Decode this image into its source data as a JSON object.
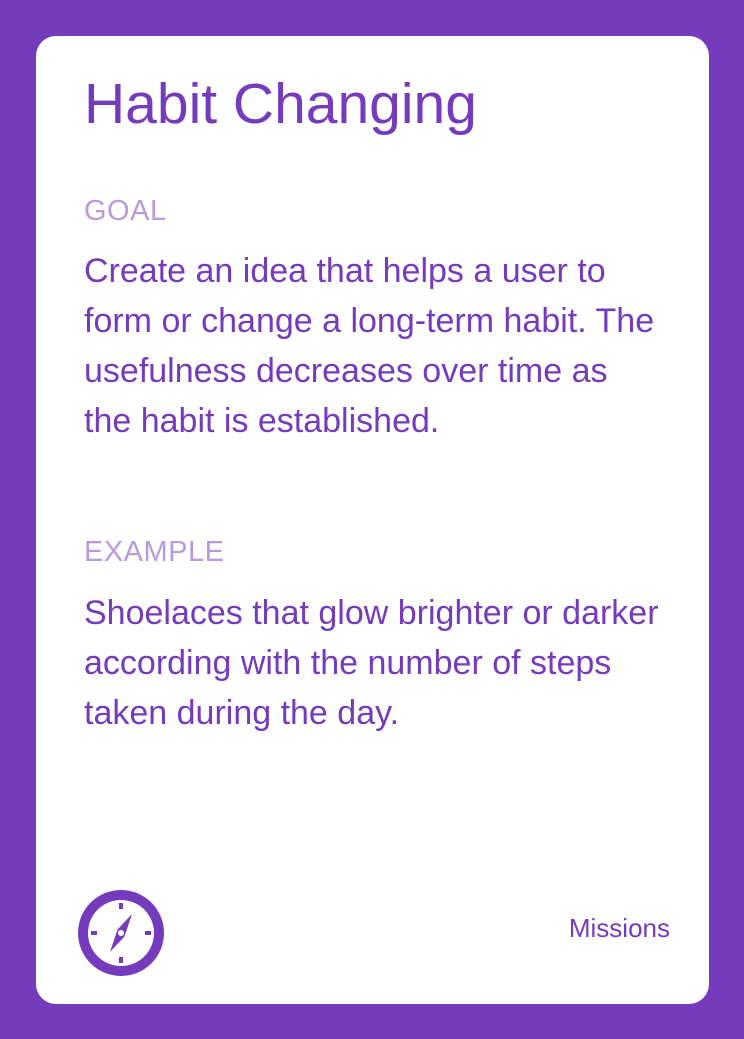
{
  "card": {
    "title": "Habit Changing",
    "goal": {
      "label": "GOAL",
      "text": "Create an idea that helps a user to form or change a long-term habit. The usefulness decreases over time as the habit is established."
    },
    "example": {
      "label": "EXAMPLE",
      "text": "Shoelaces that glow brighter or darker according with the number of steps taken during the day."
    },
    "footer": {
      "icon": "compass-icon",
      "category": "Missions"
    }
  },
  "colors": {
    "background": "#753bbd",
    "card": "#ffffff",
    "accent": "#753bbd",
    "label": "#b79bdd"
  }
}
